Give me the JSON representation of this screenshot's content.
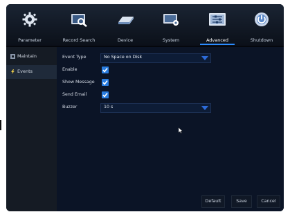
{
  "nav": {
    "items": [
      {
        "label": "Parameter",
        "icon": "gear-icon"
      },
      {
        "label": "Record Search",
        "icon": "search-icon"
      },
      {
        "label": "Device",
        "icon": "hard-drive-icon"
      },
      {
        "label": "System",
        "icon": "monitor-settings-icon"
      },
      {
        "label": "Advanced",
        "icon": "sliders-icon"
      },
      {
        "label": "Shutdown",
        "icon": "power-icon"
      }
    ],
    "active": "Advanced"
  },
  "sidebar": {
    "items": [
      {
        "label": "Maintain",
        "icon": "wrench-icon"
      },
      {
        "label": "Events",
        "icon": "lightning-icon"
      }
    ],
    "active": "Events"
  },
  "form": {
    "event_type": {
      "label": "Event Type",
      "value": "No Space on Disk"
    },
    "enable": {
      "label": "Enable",
      "checked": true
    },
    "show_message": {
      "label": "Show Message",
      "checked": true
    },
    "send_email": {
      "label": "Send Email",
      "checked": true
    },
    "buzzer": {
      "label": "Buzzer",
      "value": "10 s"
    }
  },
  "footer": {
    "default_label": "Default",
    "save_label": "Save",
    "cancel_label": "Cancel"
  },
  "colors": {
    "accent": "#2a7de0",
    "panel": "#0b1426",
    "sidebar": "#151b24"
  }
}
